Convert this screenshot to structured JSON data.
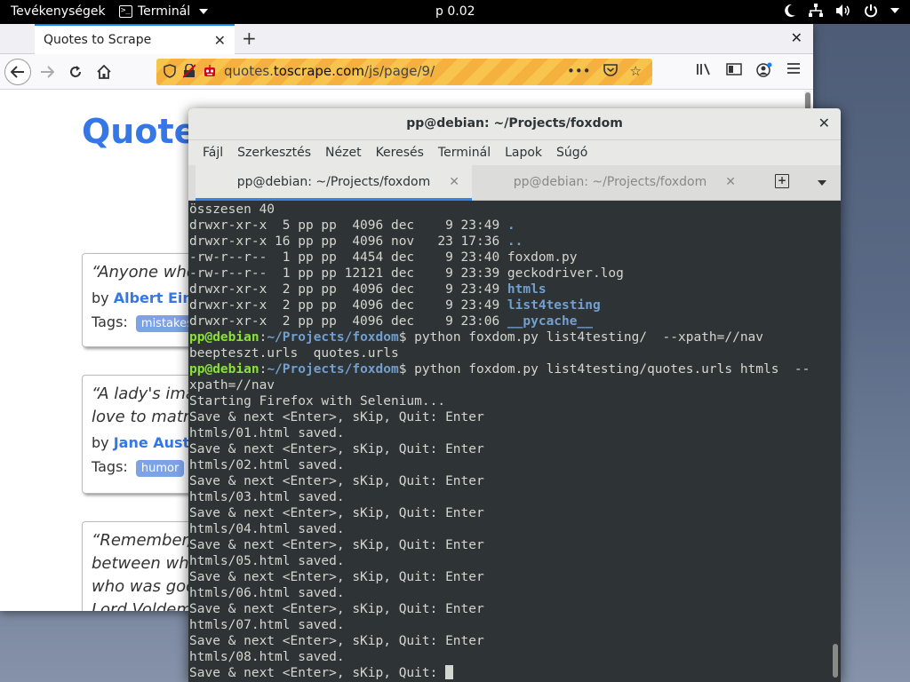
{
  "topbar": {
    "activities": "Tevékenységek",
    "app_name": "Terminál",
    "app_icon_glyph": ">_",
    "clock": "p 0.02"
  },
  "firefox": {
    "tab_title": "Quotes to Scrape",
    "url_prefix": "quotes.",
    "url_domain": "toscrape.com",
    "url_path": "/js/page/9/",
    "page": {
      "site_title": "Quotes to Scrape",
      "tags_label": "Tags:",
      "by_label": "by",
      "quotes": [
        {
          "text_lines": [
            "“Anyone who"
          ],
          "author": "Albert Einstein",
          "tags": [
            "mistakes"
          ]
        },
        {
          "text_lines": [
            "“A lady's imagination",
            "love to matrimony"
          ],
          "author": "Jane Austen",
          "tags": [
            "humor"
          ]
        },
        {
          "text_lines": [
            "“Remember, we",
            "between what",
            "who was good",
            "Lord Voldemort"
          ],
          "author": "",
          "tags": []
        }
      ]
    }
  },
  "terminal": {
    "title": "pp@debian: ~/Projects/foxdom",
    "menus": [
      "Fájl",
      "Szerkesztés",
      "Nézet",
      "Keresés",
      "Terminál",
      "Lapok",
      "Súgó"
    ],
    "tabs": [
      {
        "label": "pp@debian: ~/Projects/foxdom",
        "active": true
      },
      {
        "label": "pp@debian: ~/Projects/foxdom",
        "active": false
      }
    ],
    "prompt_user": "pp@debian",
    "prompt_path": "~/Projects/foxdom",
    "lines": [
      {
        "segs": [
          {
            "t": "összesen 40"
          }
        ]
      },
      {
        "segs": [
          {
            "t": "drwxr-xr-x  5 pp pp  4096 dec    9 23:49 "
          },
          {
            "t": ".",
            "c": "dir"
          }
        ]
      },
      {
        "segs": [
          {
            "t": "drwxr-xr-x 16 pp pp  4096 nov   23 17:36 "
          },
          {
            "t": "..",
            "c": "dir"
          }
        ]
      },
      {
        "segs": [
          {
            "t": "-rw-r--r--  1 pp pp  4454 dec    9 23:40 foxdom.py"
          }
        ]
      },
      {
        "segs": [
          {
            "t": "-rw-r--r--  1 pp pp 12121 dec    9 23:39 geckodriver.log"
          }
        ]
      },
      {
        "segs": [
          {
            "t": "drwxr-xr-x  2 pp pp  4096 dec    9 23:49 "
          },
          {
            "t": "htmls",
            "c": "dir"
          }
        ]
      },
      {
        "segs": [
          {
            "t": "drwxr-xr-x  2 pp pp  4096 dec    9 23:49 "
          },
          {
            "t": "list4testing",
            "c": "dir"
          }
        ]
      },
      {
        "segs": [
          {
            "t": "drwxr-xr-x  2 pp pp  4096 dec    9 23:06 "
          },
          {
            "t": "__pycache__",
            "c": "dir"
          }
        ]
      },
      {
        "segs": [
          {
            "t": "pp@debian",
            "c": "user"
          },
          {
            "t": ":"
          },
          {
            "t": "~/Projects/foxdom",
            "c": "path"
          },
          {
            "t": "$ python foxdom.py list4testing/  --xpath=//nav"
          }
        ]
      },
      {
        "segs": [
          {
            "t": "beepteszt.urls  quotes.urls"
          }
        ]
      },
      {
        "segs": [
          {
            "t": "pp@debian",
            "c": "user"
          },
          {
            "t": ":"
          },
          {
            "t": "~/Projects/foxdom",
            "c": "path"
          },
          {
            "t": "$ python foxdom.py list4testing/quotes.urls htmls  --"
          }
        ]
      },
      {
        "segs": [
          {
            "t": "xpath=//nav"
          }
        ]
      },
      {
        "segs": [
          {
            "t": "Starting Firefox with Selenium..."
          }
        ]
      },
      {
        "segs": [
          {
            "t": "Save & next <Enter>, sKip, Quit: Enter"
          }
        ]
      },
      {
        "segs": [
          {
            "t": "htmls/01.html saved."
          }
        ]
      },
      {
        "segs": [
          {
            "t": "Save & next <Enter>, sKip, Quit: Enter"
          }
        ]
      },
      {
        "segs": [
          {
            "t": "htmls/02.html saved."
          }
        ]
      },
      {
        "segs": [
          {
            "t": "Save & next <Enter>, sKip, Quit: Enter"
          }
        ]
      },
      {
        "segs": [
          {
            "t": "htmls/03.html saved."
          }
        ]
      },
      {
        "segs": [
          {
            "t": "Save & next <Enter>, sKip, Quit: Enter"
          }
        ]
      },
      {
        "segs": [
          {
            "t": "htmls/04.html saved."
          }
        ]
      },
      {
        "segs": [
          {
            "t": "Save & next <Enter>, sKip, Quit: Enter"
          }
        ]
      },
      {
        "segs": [
          {
            "t": "htmls/05.html saved."
          }
        ]
      },
      {
        "segs": [
          {
            "t": "Save & next <Enter>, sKip, Quit: Enter"
          }
        ]
      },
      {
        "segs": [
          {
            "t": "htmls/06.html saved."
          }
        ]
      },
      {
        "segs": [
          {
            "t": "Save & next <Enter>, sKip, Quit: Enter"
          }
        ]
      },
      {
        "segs": [
          {
            "t": "htmls/07.html saved."
          }
        ]
      },
      {
        "segs": [
          {
            "t": "Save & next <Enter>, sKip, Quit: Enter"
          }
        ]
      },
      {
        "segs": [
          {
            "t": "htmls/08.html saved."
          }
        ]
      },
      {
        "segs": [
          {
            "t": "Save & next <Enter>, sKip, Quit: "
          }
        ],
        "cursor": true
      }
    ]
  },
  "colors": {
    "terminal_bg": "#2e3436",
    "terminal_fg": "#d3d7cf",
    "prompt_green": "#8ae234",
    "dir_blue": "#729fcf",
    "link_blue": "#3677e8",
    "tab_accent": "#3584e4"
  }
}
